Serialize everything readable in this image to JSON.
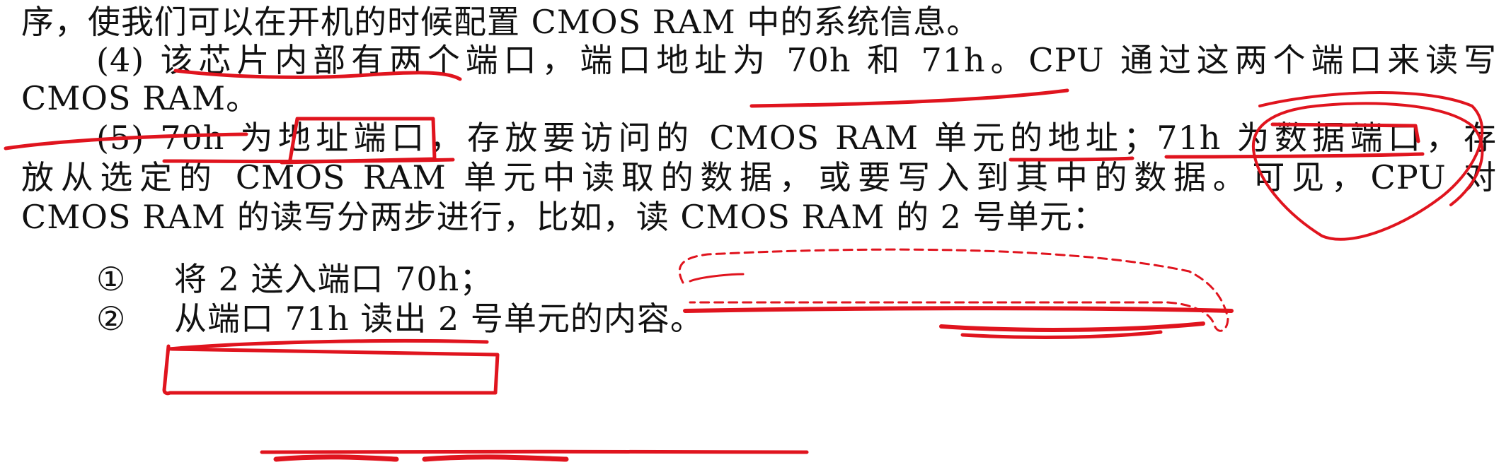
{
  "document": {
    "lines": [
      {
        "id": "l1",
        "text": "序，使我们可以在开机的时候配置 CMOS RAM 中的系统信息。"
      },
      {
        "id": "l2",
        "text": "(4)  该芯片内部有两个端口，端口地址为 70h 和 71h。CPU 通过这两个端口来读写"
      },
      {
        "id": "l3",
        "text": "CMOS RAM。"
      },
      {
        "id": "l4",
        "text": "(5)  70h 为地址端口，存放要访问的 CMOS RAM 单元的地址；71h 为数据端口，存"
      },
      {
        "id": "l5",
        "text": "放从选定的 CMOS RAM 单元中读取的数据，或要写入到其中的数据。可见，CPU 对"
      },
      {
        "id": "l6",
        "text": "CMOS RAM 的读写分两步进行，比如，读 CMOS RAM 的 2 号单元："
      }
    ],
    "steps": [
      {
        "marker": "①",
        "text": "将 2 送入端口 70h；"
      },
      {
        "marker": "②",
        "text": "从端口 71h 读出 2 号单元的内容。"
      }
    ]
  },
  "annotation_color": "#e0141e"
}
